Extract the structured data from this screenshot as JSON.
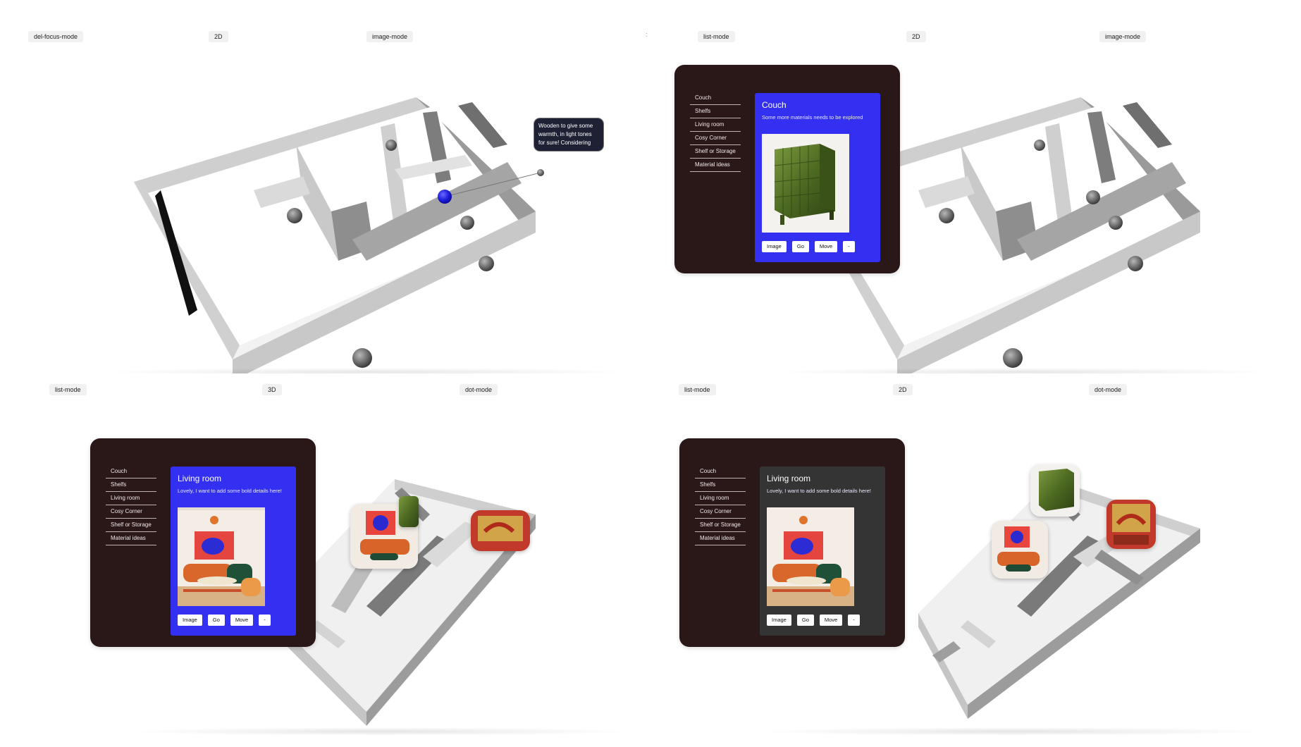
{
  "quadrants": [
    {
      "labels": [
        "del-focus-mode",
        "2D",
        "image-mode"
      ]
    },
    {
      "labels": [
        "list-mode",
        "2D",
        "image-mode"
      ]
    },
    {
      "labels": [
        "list-mode",
        "3D",
        "dot-mode"
      ]
    },
    {
      "labels": [
        "list-mode",
        "2D",
        "dot-mode"
      ]
    }
  ],
  "separator": ":",
  "tooltip": {
    "text": "Wooden to give some warmth, in light tones for sure! Considering"
  },
  "sidebar": {
    "items": [
      {
        "label": "Couch"
      },
      {
        "label": "Shelfs"
      },
      {
        "label": "Living room"
      },
      {
        "label": "Cosy Corner"
      },
      {
        "label": "Shelf or Storage"
      },
      {
        "label": "Material ideas"
      }
    ]
  },
  "couch_card": {
    "title": "Couch",
    "subtitle": "Some more materials needs to be explored"
  },
  "living_card": {
    "title": "Living room",
    "subtitle": "Lovely, I want to add some bold details here!"
  },
  "buttons": {
    "image": "Image",
    "go": "Go",
    "move": "Move",
    "more": "-"
  },
  "colors": {
    "panel": "#2a1718",
    "accent_blue": "#3430f2",
    "card_dark": "#343434",
    "tooltip": "#1e2133",
    "model_wall": "#d4d4d4"
  },
  "icons": {
    "marker": "sphere-marker-icon",
    "selected_marker": "selected-sphere-icon"
  }
}
